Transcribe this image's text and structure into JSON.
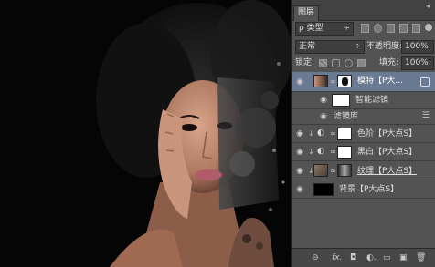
{
  "panel": {
    "tab_title": "图层",
    "collapse_glyph": "◂",
    "filter": {
      "label": "ρ 类型",
      "arrow": "÷"
    },
    "blend_mode": {
      "value": "正常",
      "arrow": "÷"
    },
    "opacity": {
      "label": "不透明度:",
      "value": "100%"
    },
    "lock_label": "锁定:",
    "fill": {
      "label": "填充:",
      "value": "100%"
    },
    "layers": [
      {
        "name": "模特【P大...",
        "selected": true
      },
      {
        "name": "智能滤镜"
      },
      {
        "name": "滤镜库"
      },
      {
        "name": "色阶【P大点S】"
      },
      {
        "name": "黑白【P大点S】"
      },
      {
        "name": "纹理【P大点S】"
      },
      {
        "name": "背景【P大点S】"
      }
    ],
    "bottom_icons": [
      "link-icon",
      "fx-icon",
      "mask-icon",
      "adjustment-icon",
      "folder-icon",
      "new-layer-icon",
      "trash-icon"
    ],
    "bottom_glyphs": {
      "link": "⊖",
      "fx": "fx.",
      "mask": "◘",
      "adjust": "◐.",
      "folder": "▭",
      "new": "▣",
      "trash": "🗑"
    }
  },
  "colors": {
    "panel_bg": "#535353",
    "selected_bg": "#6a7a92"
  }
}
